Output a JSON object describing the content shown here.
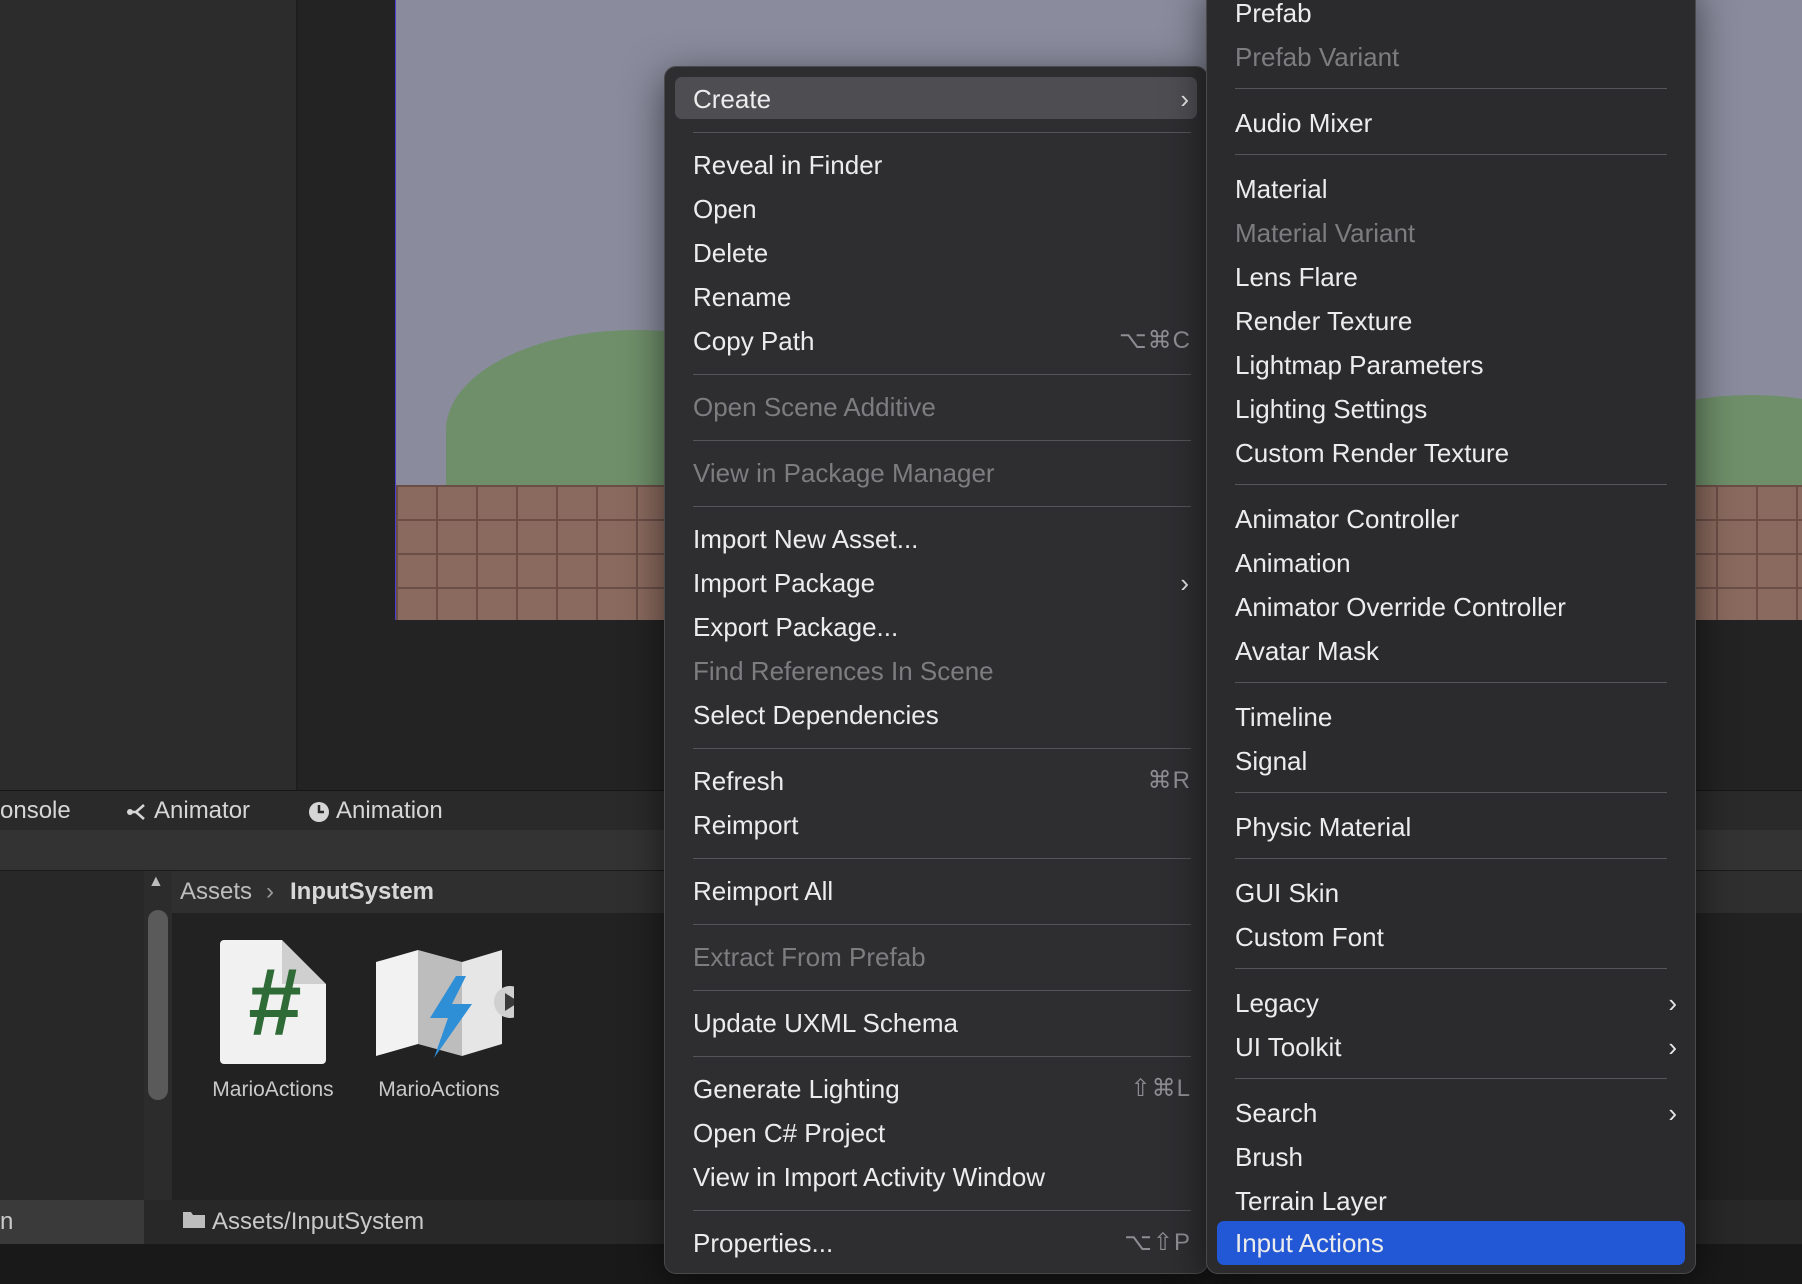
{
  "tabs": [
    {
      "label": "onsole",
      "icon": ""
    },
    {
      "label": "Animator",
      "icon": "animator-icon"
    },
    {
      "label": "Animation",
      "icon": "clock-icon"
    }
  ],
  "breadcrumb": {
    "root": "Assets",
    "current": "InputSystem"
  },
  "assets": [
    {
      "label": "MarioActions",
      "icon": "csharp-script-icon"
    },
    {
      "label": "MarioActions",
      "icon": "input-actions-icon"
    }
  ],
  "status": {
    "path": "Assets/InputSystem",
    "left_text": "n"
  },
  "context_menu": {
    "items": [
      {
        "label": "Create",
        "submenu": true,
        "highlighted": true
      },
      {
        "label": "Reveal in Finder"
      },
      {
        "label": "Open"
      },
      {
        "label": "Delete"
      },
      {
        "label": "Rename"
      },
      {
        "label": "Copy Path",
        "shortcut": "⌥⌘C"
      },
      {
        "label": "Open Scene Additive",
        "disabled": true
      },
      {
        "label": "View in Package Manager",
        "disabled": true
      },
      {
        "label": "Import New Asset..."
      },
      {
        "label": "Import Package",
        "submenu": true
      },
      {
        "label": "Export Package..."
      },
      {
        "label": "Find References In Scene",
        "disabled": true
      },
      {
        "label": "Select Dependencies"
      },
      {
        "label": "Refresh",
        "shortcut": "⌘R"
      },
      {
        "label": "Reimport"
      },
      {
        "label": "Reimport All"
      },
      {
        "label": "Extract From Prefab",
        "disabled": true
      },
      {
        "label": "Update UXML Schema"
      },
      {
        "label": "Generate Lighting",
        "shortcut": "⇧⌘L"
      },
      {
        "label": "Open C# Project"
      },
      {
        "label": "View in Import Activity Window"
      },
      {
        "label": "Properties...",
        "shortcut": "⌥⇧P"
      }
    ]
  },
  "create_submenu": {
    "items": [
      {
        "label": "Prefab"
      },
      {
        "label": "Prefab Variant",
        "disabled": true
      },
      {
        "label": "Audio Mixer"
      },
      {
        "label": "Material"
      },
      {
        "label": "Material Variant",
        "disabled": true
      },
      {
        "label": "Lens Flare"
      },
      {
        "label": "Render Texture"
      },
      {
        "label": "Lightmap Parameters"
      },
      {
        "label": "Lighting Settings"
      },
      {
        "label": "Custom Render Texture"
      },
      {
        "label": "Animator Controller"
      },
      {
        "label": "Animation"
      },
      {
        "label": "Animator Override Controller"
      },
      {
        "label": "Avatar Mask"
      },
      {
        "label": "Timeline"
      },
      {
        "label": "Signal"
      },
      {
        "label": "Physic Material"
      },
      {
        "label": "GUI Skin"
      },
      {
        "label": "Custom Font"
      },
      {
        "label": "Legacy",
        "submenu": true
      },
      {
        "label": "UI Toolkit",
        "submenu": true
      },
      {
        "label": "Search",
        "submenu": true
      },
      {
        "label": "Brush"
      },
      {
        "label": "Terrain Layer"
      },
      {
        "label": "Input Actions",
        "highlighted": true
      }
    ]
  },
  "colors": {
    "highlight": "#2257d5",
    "menu_bg": "#2e2e31",
    "disabled_text": "#7d7d80"
  }
}
